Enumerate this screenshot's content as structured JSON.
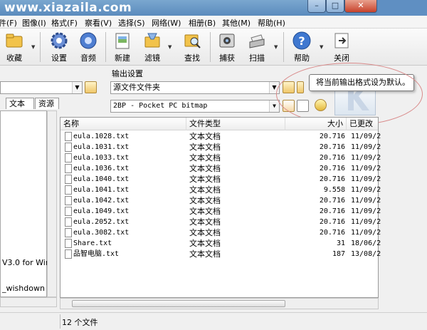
{
  "watermark": "www.xiazaila.com",
  "window": {
    "minimize": "–",
    "maximize": "□",
    "close": "✕"
  },
  "menu": [
    "件(F)",
    "图像(I)",
    "格式(F)",
    "察看(V)",
    "选择(S)",
    "网络(W)",
    "相册(B)",
    "其他(M)",
    "帮助(H)"
  ],
  "toolbar": {
    "items": [
      "收藏",
      "设置",
      "音频",
      "新建",
      "滤镜",
      "查找",
      "捕获",
      "扫描",
      "帮助",
      "关闭"
    ],
    "icons": [
      "folder-icon",
      "gear-icon",
      "audio-icon",
      "new-doc-icon",
      "filter-icon",
      "find-icon",
      "camera-icon",
      "scanner-icon",
      "help-icon",
      "exit-icon"
    ]
  },
  "output": {
    "label": "输出设置",
    "folder_value": "源文件文件夹",
    "format_value": "2BP - Pocket PC bitmap"
  },
  "tooltip": "将当前输出格式设为默认。",
  "left": {
    "tabs": [
      "文本",
      "资源"
    ],
    "lines": [
      "V3.0 for Wir",
      "_wishdown"
    ]
  },
  "filelist": {
    "columns": [
      "名称",
      "文件类型",
      "大小",
      "已更改"
    ],
    "rows": [
      {
        "name": "eula.1028.txt",
        "type": "文本文档",
        "size": "20.716",
        "date": "11/09/2"
      },
      {
        "name": "eula.1031.txt",
        "type": "文本文档",
        "size": "20.716",
        "date": "11/09/2"
      },
      {
        "name": "eula.1033.txt",
        "type": "文本文档",
        "size": "20.716",
        "date": "11/09/2"
      },
      {
        "name": "eula.1036.txt",
        "type": "文本文档",
        "size": "20.716",
        "date": "11/09/2"
      },
      {
        "name": "eula.1040.txt",
        "type": "文本文档",
        "size": "20.716",
        "date": "11/09/2"
      },
      {
        "name": "eula.1041.txt",
        "type": "文本文档",
        "size": "9.558",
        "date": "11/09/2"
      },
      {
        "name": "eula.1042.txt",
        "type": "文本文档",
        "size": "20.716",
        "date": "11/09/2"
      },
      {
        "name": "eula.1049.txt",
        "type": "文本文档",
        "size": "20.716",
        "date": "11/09/2"
      },
      {
        "name": "eula.2052.txt",
        "type": "文本文档",
        "size": "20.716",
        "date": "11/09/2"
      },
      {
        "name": "eula.3082.txt",
        "type": "文本文档",
        "size": "20.716",
        "date": "11/09/2"
      },
      {
        "name": "Share.txt",
        "type": "文本文档",
        "size": "31",
        "date": "18/06/2"
      },
      {
        "name": "品智电脑.txt",
        "type": "文本文档",
        "size": "187",
        "date": "13/08/2"
      }
    ]
  },
  "status": "12 个文件",
  "colors": {
    "annotation": "#d98a8a",
    "titlebar": "#5b8bbd"
  }
}
